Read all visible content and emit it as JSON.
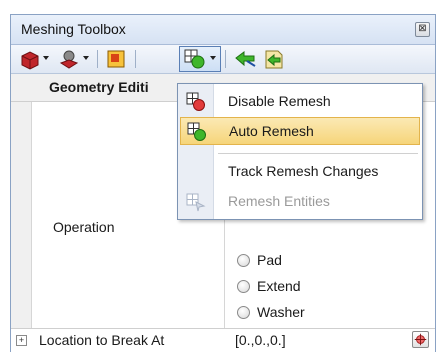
{
  "panel": {
    "title": "Meshing Toolbox",
    "close_glyph": "⊠"
  },
  "toolbar": {
    "buttons": [
      {
        "icon": "red-solid-icon"
      },
      {
        "icon": "red-feature-icon"
      },
      {
        "icon": "orange-square-icon"
      },
      {
        "icon": "remesh-icon"
      },
      {
        "icon": "green-arrow-icon"
      },
      {
        "icon": "green-page-icon"
      }
    ]
  },
  "grid": {
    "group_label": "Geometry Editi",
    "operation_label": "Operation",
    "radio_options": [
      "Pad",
      "Extend",
      "Washer"
    ],
    "location_label": "Location to Break At",
    "location_value": "[0.,0.,0.]",
    "expander_glyph": "+"
  },
  "menu": {
    "items": [
      {
        "label": "Disable Remesh",
        "icon": "remesh-disable-icon",
        "disabled": false
      },
      {
        "label": "Auto Remesh",
        "icon": "remesh-auto-icon",
        "disabled": false,
        "highlighted": true
      },
      {
        "label": "Track Remesh Changes",
        "icon": "",
        "disabled": false
      },
      {
        "label": "Remesh Entities",
        "icon": "remesh-entities-icon",
        "disabled": true
      }
    ]
  },
  "colors": {
    "accent_border": "#5a7fb5",
    "highlight": "#f6d57a",
    "title_gradient": "#d6e2f3"
  }
}
